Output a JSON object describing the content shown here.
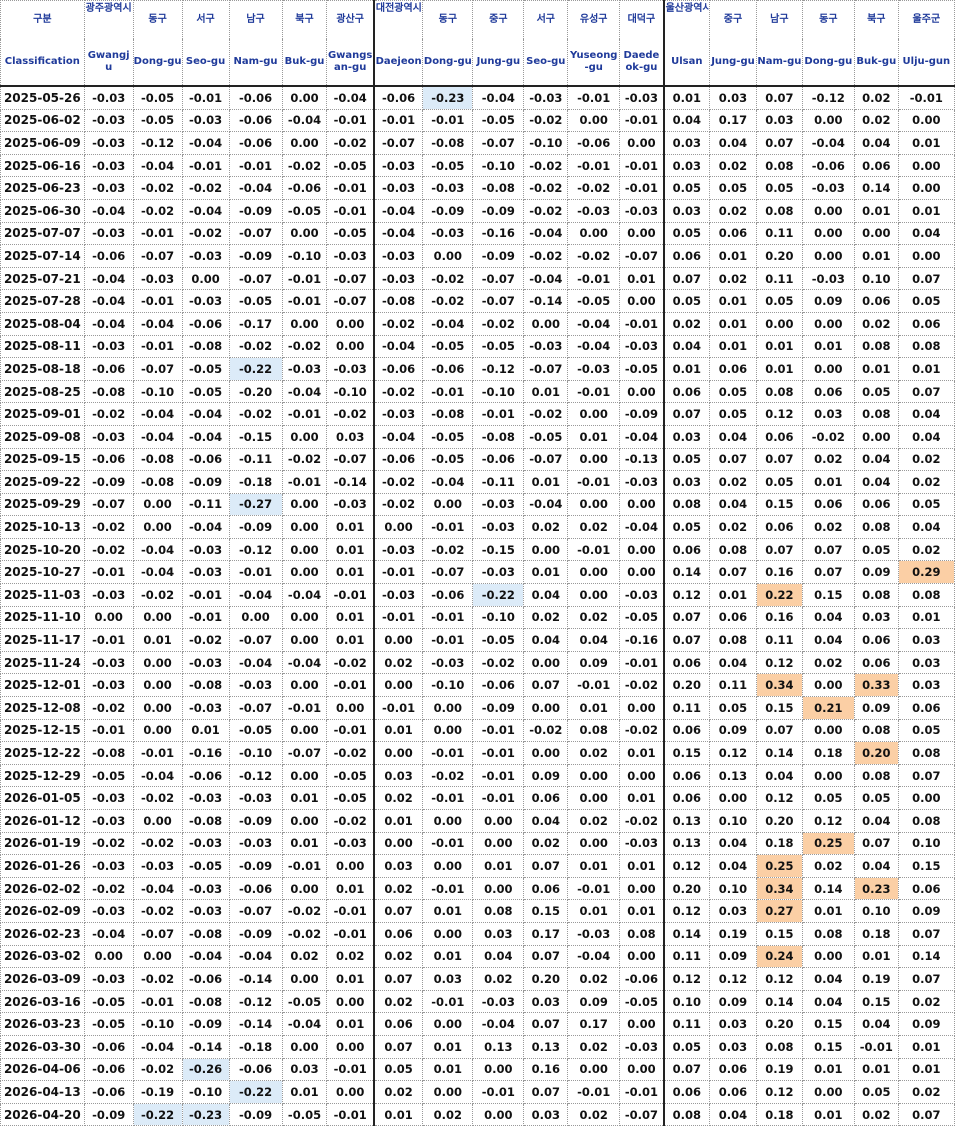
{
  "colors": {
    "header_text": "#1f3a9a",
    "negative_highlight": "#dcebf8",
    "positive_highlight": "#fbcfa5"
  },
  "header": {
    "ko": [
      "구분",
      "광주광역시",
      "동구",
      "서구",
      "남구",
      "북구",
      "광산구",
      "대전광역시",
      "동구",
      "중구",
      "서구",
      "유성구",
      "대덕구",
      "울산광역시",
      "중구",
      "남구",
      "동구",
      "북구",
      "울주군"
    ],
    "en": [
      "Classification",
      "Gwangju",
      "Dong-gu",
      "Seo-gu",
      "Nam-gu",
      "Buk-gu",
      "Gwangsan-gu",
      "Daejeon",
      "Dong-gu",
      "Jung-gu",
      "Seo-gu",
      "Yuseong-gu",
      "Daedeok-gu",
      "Ulsan",
      "Jung-gu",
      "Nam-gu",
      "Dong-gu",
      "Buk-gu",
      "Ulju-gun"
    ]
  },
  "rows": [
    [
      "2025-05-26",
      "-0.03",
      "-0.05",
      "-0.01",
      "-0.06",
      "0.00",
      "-0.04",
      "-0.06",
      "-0.23",
      "-0.04",
      "-0.03",
      "-0.01",
      "-0.03",
      "0.01",
      "0.03",
      "0.07",
      "-0.12",
      "0.02",
      "-0.01"
    ],
    [
      "2025-06-02",
      "-0.03",
      "-0.05",
      "-0.03",
      "-0.06",
      "-0.04",
      "-0.01",
      "-0.01",
      "-0.01",
      "-0.05",
      "-0.02",
      "0.00",
      "-0.01",
      "0.04",
      "0.17",
      "0.03",
      "0.00",
      "0.02",
      "0.00"
    ],
    [
      "2025-06-09",
      "-0.03",
      "-0.12",
      "-0.04",
      "-0.06",
      "0.00",
      "-0.02",
      "-0.07",
      "-0.08",
      "-0.07",
      "-0.10",
      "-0.06",
      "0.00",
      "0.03",
      "0.04",
      "0.07",
      "-0.04",
      "0.04",
      "0.01"
    ],
    [
      "2025-06-16",
      "-0.03",
      "-0.04",
      "-0.01",
      "-0.01",
      "-0.02",
      "-0.05",
      "-0.03",
      "-0.05",
      "-0.10",
      "-0.02",
      "-0.01",
      "-0.01",
      "0.03",
      "0.02",
      "0.08",
      "-0.06",
      "0.06",
      "0.00"
    ],
    [
      "2025-06-23",
      "-0.03",
      "-0.02",
      "-0.02",
      "-0.04",
      "-0.06",
      "-0.01",
      "-0.03",
      "-0.03",
      "-0.08",
      "-0.02",
      "-0.02",
      "-0.01",
      "0.05",
      "0.05",
      "0.05",
      "-0.03",
      "0.14",
      "0.00"
    ],
    [
      "2025-06-30",
      "-0.04",
      "-0.02",
      "-0.04",
      "-0.09",
      "-0.05",
      "-0.01",
      "-0.04",
      "-0.09",
      "-0.09",
      "-0.02",
      "-0.03",
      "-0.03",
      "0.03",
      "0.02",
      "0.08",
      "0.00",
      "0.01",
      "0.01"
    ],
    [
      "2025-07-07",
      "-0.03",
      "-0.01",
      "-0.02",
      "-0.07",
      "0.00",
      "-0.05",
      "-0.04",
      "-0.03",
      "-0.16",
      "-0.04",
      "0.00",
      "0.00",
      "0.05",
      "0.06",
      "0.11",
      "0.00",
      "0.00",
      "0.04"
    ],
    [
      "2025-07-14",
      "-0.06",
      "-0.07",
      "-0.03",
      "-0.09",
      "-0.10",
      "-0.03",
      "-0.03",
      "0.00",
      "-0.09",
      "-0.02",
      "-0.02",
      "-0.07",
      "0.06",
      "0.01",
      "0.20",
      "0.00",
      "0.01",
      "0.00"
    ],
    [
      "2025-07-21",
      "-0.04",
      "-0.03",
      "0.00",
      "-0.07",
      "-0.01",
      "-0.07",
      "-0.03",
      "-0.02",
      "-0.07",
      "-0.04",
      "-0.01",
      "0.01",
      "0.07",
      "0.02",
      "0.11",
      "-0.03",
      "0.10",
      "0.07"
    ],
    [
      "2025-07-28",
      "-0.04",
      "-0.01",
      "-0.03",
      "-0.05",
      "-0.01",
      "-0.07",
      "-0.08",
      "-0.02",
      "-0.07",
      "-0.14",
      "-0.05",
      "0.00",
      "0.05",
      "0.01",
      "0.05",
      "0.09",
      "0.06",
      "0.05"
    ],
    [
      "2025-08-04",
      "-0.04",
      "-0.04",
      "-0.06",
      "-0.17",
      "0.00",
      "0.00",
      "-0.02",
      "-0.04",
      "-0.02",
      "0.00",
      "-0.04",
      "-0.01",
      "0.02",
      "0.01",
      "0.00",
      "0.00",
      "0.02",
      "0.06"
    ],
    [
      "2025-08-11",
      "-0.03",
      "-0.01",
      "-0.08",
      "-0.02",
      "-0.02",
      "0.00",
      "-0.04",
      "-0.05",
      "-0.05",
      "-0.03",
      "-0.04",
      "-0.03",
      "0.04",
      "0.01",
      "0.01",
      "0.01",
      "0.08",
      "0.08"
    ],
    [
      "2025-08-18",
      "-0.06",
      "-0.07",
      "-0.05",
      "-0.22",
      "-0.03",
      "-0.03",
      "-0.06",
      "-0.06",
      "-0.12",
      "-0.07",
      "-0.03",
      "-0.05",
      "0.01",
      "0.06",
      "0.01",
      "0.00",
      "0.01",
      "0.01"
    ],
    [
      "2025-08-25",
      "-0.08",
      "-0.10",
      "-0.05",
      "-0.20",
      "-0.04",
      "-0.10",
      "-0.02",
      "-0.01",
      "-0.10",
      "0.01",
      "-0.01",
      "0.00",
      "0.06",
      "0.05",
      "0.08",
      "0.06",
      "0.05",
      "0.07"
    ],
    [
      "2025-09-01",
      "-0.02",
      "-0.04",
      "-0.04",
      "-0.02",
      "-0.01",
      "-0.02",
      "-0.03",
      "-0.08",
      "-0.01",
      "-0.02",
      "0.00",
      "-0.09",
      "0.07",
      "0.05",
      "0.12",
      "0.03",
      "0.08",
      "0.04"
    ],
    [
      "2025-09-08",
      "-0.03",
      "-0.04",
      "-0.04",
      "-0.15",
      "0.00",
      "0.03",
      "-0.04",
      "-0.05",
      "-0.08",
      "-0.05",
      "0.01",
      "-0.04",
      "0.03",
      "0.04",
      "0.06",
      "-0.02",
      "0.00",
      "0.04"
    ],
    [
      "2025-09-15",
      "-0.06",
      "-0.08",
      "-0.06",
      "-0.11",
      "-0.02",
      "-0.07",
      "-0.06",
      "-0.05",
      "-0.06",
      "-0.07",
      "0.00",
      "-0.13",
      "0.05",
      "0.07",
      "0.07",
      "0.02",
      "0.04",
      "0.02"
    ],
    [
      "2025-09-22",
      "-0.09",
      "-0.08",
      "-0.09",
      "-0.18",
      "-0.01",
      "-0.14",
      "-0.02",
      "-0.04",
      "-0.11",
      "0.01",
      "-0.01",
      "-0.03",
      "0.03",
      "0.02",
      "0.05",
      "0.01",
      "0.04",
      "0.02"
    ],
    [
      "2025-09-29",
      "-0.07",
      "0.00",
      "-0.11",
      "-0.27",
      "0.00",
      "-0.03",
      "-0.02",
      "0.00",
      "-0.03",
      "-0.04",
      "0.00",
      "0.00",
      "0.08",
      "0.04",
      "0.15",
      "0.06",
      "0.06",
      "0.05"
    ],
    [
      "2025-10-13",
      "-0.02",
      "0.00",
      "-0.04",
      "-0.09",
      "0.00",
      "0.01",
      "0.00",
      "-0.01",
      "-0.03",
      "0.02",
      "0.02",
      "-0.04",
      "0.05",
      "0.02",
      "0.06",
      "0.02",
      "0.08",
      "0.04"
    ],
    [
      "2025-10-20",
      "-0.02",
      "-0.04",
      "-0.03",
      "-0.12",
      "0.00",
      "0.01",
      "-0.03",
      "-0.02",
      "-0.15",
      "0.00",
      "-0.01",
      "0.00",
      "0.06",
      "0.08",
      "0.07",
      "0.07",
      "0.05",
      "0.02"
    ],
    [
      "2025-10-27",
      "-0.01",
      "-0.04",
      "-0.03",
      "-0.01",
      "0.00",
      "0.01",
      "-0.01",
      "-0.07",
      "-0.03",
      "0.01",
      "0.00",
      "0.00",
      "0.14",
      "0.07",
      "0.16",
      "0.07",
      "0.09",
      "0.29"
    ],
    [
      "2025-11-03",
      "-0.03",
      "-0.02",
      "-0.01",
      "-0.04",
      "-0.04",
      "-0.01",
      "-0.03",
      "-0.06",
      "-0.22",
      "0.04",
      "0.00",
      "-0.03",
      "0.12",
      "0.01",
      "0.22",
      "0.15",
      "0.08",
      "0.08"
    ],
    [
      "2025-11-10",
      "0.00",
      "0.00",
      "-0.01",
      "0.00",
      "0.00",
      "0.01",
      "-0.01",
      "-0.01",
      "-0.10",
      "0.02",
      "0.02",
      "-0.05",
      "0.07",
      "0.06",
      "0.16",
      "0.04",
      "0.03",
      "0.01"
    ],
    [
      "2025-11-17",
      "-0.01",
      "0.01",
      "-0.02",
      "-0.07",
      "0.00",
      "0.01",
      "0.00",
      "-0.01",
      "-0.05",
      "0.04",
      "0.04",
      "-0.16",
      "0.07",
      "0.08",
      "0.11",
      "0.04",
      "0.06",
      "0.03"
    ],
    [
      "2025-11-24",
      "-0.03",
      "0.00",
      "-0.03",
      "-0.04",
      "-0.04",
      "-0.02",
      "0.02",
      "-0.03",
      "-0.02",
      "0.00",
      "0.09",
      "-0.01",
      "0.06",
      "0.04",
      "0.12",
      "0.02",
      "0.06",
      "0.03"
    ],
    [
      "2025-12-01",
      "-0.03",
      "0.00",
      "-0.08",
      "-0.03",
      "0.00",
      "-0.01",
      "0.00",
      "-0.10",
      "-0.06",
      "0.07",
      "-0.01",
      "-0.02",
      "0.20",
      "0.11",
      "0.34",
      "0.00",
      "0.33",
      "0.03"
    ],
    [
      "2025-12-08",
      "-0.02",
      "0.00",
      "-0.03",
      "-0.07",
      "-0.01",
      "0.00",
      "-0.01",
      "0.00",
      "-0.09",
      "0.00",
      "0.01",
      "0.00",
      "0.11",
      "0.05",
      "0.15",
      "0.21",
      "0.09",
      "0.06"
    ],
    [
      "2025-12-15",
      "-0.01",
      "0.00",
      "0.01",
      "-0.05",
      "0.00",
      "-0.01",
      "0.01",
      "0.00",
      "-0.01",
      "-0.02",
      "0.08",
      "-0.02",
      "0.06",
      "0.09",
      "0.07",
      "0.00",
      "0.08",
      "0.05"
    ],
    [
      "2025-12-22",
      "-0.08",
      "-0.01",
      "-0.16",
      "-0.10",
      "-0.07",
      "-0.02",
      "0.00",
      "-0.01",
      "-0.01",
      "0.00",
      "0.02",
      "0.01",
      "0.15",
      "0.12",
      "0.14",
      "0.18",
      "0.20",
      "0.08"
    ],
    [
      "2025-12-29",
      "-0.05",
      "-0.04",
      "-0.06",
      "-0.12",
      "0.00",
      "-0.05",
      "0.03",
      "-0.02",
      "-0.01",
      "0.09",
      "0.00",
      "0.00",
      "0.06",
      "0.13",
      "0.04",
      "0.00",
      "0.08",
      "0.07"
    ],
    [
      "2026-01-05",
      "-0.03",
      "-0.02",
      "-0.03",
      "-0.03",
      "0.01",
      "-0.05",
      "0.02",
      "-0.01",
      "-0.01",
      "0.06",
      "0.00",
      "0.01",
      "0.06",
      "0.00",
      "0.12",
      "0.05",
      "0.05",
      "0.00"
    ],
    [
      "2026-01-12",
      "-0.03",
      "0.00",
      "-0.08",
      "-0.09",
      "0.00",
      "-0.02",
      "0.01",
      "0.00",
      "0.00",
      "0.04",
      "0.02",
      "-0.02",
      "0.13",
      "0.10",
      "0.20",
      "0.12",
      "0.04",
      "0.08"
    ],
    [
      "2026-01-19",
      "-0.02",
      "-0.02",
      "-0.03",
      "-0.03",
      "0.01",
      "-0.03",
      "0.00",
      "-0.01",
      "0.00",
      "0.02",
      "0.00",
      "-0.03",
      "0.13",
      "0.04",
      "0.18",
      "0.25",
      "0.07",
      "0.10"
    ],
    [
      "2026-01-26",
      "-0.03",
      "-0.03",
      "-0.05",
      "-0.09",
      "-0.01",
      "0.00",
      "0.03",
      "0.00",
      "0.01",
      "0.07",
      "0.01",
      "0.01",
      "0.12",
      "0.04",
      "0.25",
      "0.02",
      "0.04",
      "0.15"
    ],
    [
      "2026-02-02",
      "-0.02",
      "-0.04",
      "-0.03",
      "-0.06",
      "0.00",
      "0.01",
      "0.02",
      "-0.01",
      "0.00",
      "0.06",
      "-0.01",
      "0.00",
      "0.20",
      "0.10",
      "0.34",
      "0.14",
      "0.23",
      "0.06"
    ],
    [
      "2026-02-09",
      "-0.03",
      "-0.02",
      "-0.03",
      "-0.07",
      "-0.02",
      "-0.01",
      "0.07",
      "0.01",
      "0.08",
      "0.15",
      "0.01",
      "0.01",
      "0.12",
      "0.03",
      "0.27",
      "0.01",
      "0.10",
      "0.09"
    ],
    [
      "2026-02-23",
      "-0.04",
      "-0.07",
      "-0.08",
      "-0.09",
      "-0.02",
      "-0.01",
      "0.06",
      "0.00",
      "0.03",
      "0.17",
      "-0.03",
      "0.08",
      "0.14",
      "0.19",
      "0.15",
      "0.08",
      "0.18",
      "0.07"
    ],
    [
      "2026-03-02",
      "0.00",
      "0.00",
      "-0.04",
      "-0.04",
      "0.02",
      "0.02",
      "0.02",
      "0.01",
      "0.04",
      "0.07",
      "-0.04",
      "0.00",
      "0.11",
      "0.09",
      "0.24",
      "0.00",
      "0.01",
      "0.14"
    ],
    [
      "2026-03-09",
      "-0.03",
      "-0.02",
      "-0.06",
      "-0.14",
      "0.00",
      "0.01",
      "0.07",
      "0.03",
      "0.02",
      "0.20",
      "0.02",
      "-0.06",
      "0.12",
      "0.12",
      "0.12",
      "0.04",
      "0.19",
      "0.07"
    ],
    [
      "2026-03-16",
      "-0.05",
      "-0.01",
      "-0.08",
      "-0.12",
      "-0.05",
      "0.00",
      "0.02",
      "-0.01",
      "-0.03",
      "0.03",
      "0.09",
      "-0.05",
      "0.10",
      "0.09",
      "0.14",
      "0.04",
      "0.15",
      "0.02"
    ],
    [
      "2026-03-23",
      "-0.05",
      "-0.10",
      "-0.09",
      "-0.14",
      "-0.04",
      "0.01",
      "0.06",
      "0.00",
      "-0.04",
      "0.07",
      "0.17",
      "0.00",
      "0.11",
      "0.03",
      "0.20",
      "0.15",
      "0.04",
      "0.09"
    ],
    [
      "2026-03-30",
      "-0.06",
      "-0.04",
      "-0.14",
      "-0.18",
      "0.00",
      "0.00",
      "0.07",
      "0.01",
      "0.13",
      "0.13",
      "0.02",
      "-0.03",
      "0.05",
      "0.03",
      "0.08",
      "0.15",
      "-0.01",
      "0.01"
    ],
    [
      "2026-04-06",
      "-0.06",
      "-0.02",
      "-0.26",
      "-0.06",
      "0.03",
      "-0.01",
      "0.05",
      "0.01",
      "0.00",
      "0.16",
      "0.00",
      "0.00",
      "0.07",
      "0.06",
      "0.19",
      "0.01",
      "0.01",
      "0.01"
    ],
    [
      "2026-04-13",
      "-0.06",
      "-0.19",
      "-0.10",
      "-0.22",
      "0.01",
      "0.00",
      "0.02",
      "0.00",
      "-0.01",
      "0.07",
      "-0.01",
      "-0.01",
      "0.06",
      "0.06",
      "0.12",
      "0.00",
      "0.05",
      "0.02"
    ],
    [
      "2026-04-20",
      "-0.09",
      "-0.22",
      "-0.23",
      "-0.09",
      "-0.05",
      "-0.01",
      "0.01",
      "0.02",
      "0.00",
      "0.03",
      "0.02",
      "-0.07",
      "0.08",
      "0.04",
      "0.18",
      "0.01",
      "0.02",
      "0.07"
    ]
  ]
}
